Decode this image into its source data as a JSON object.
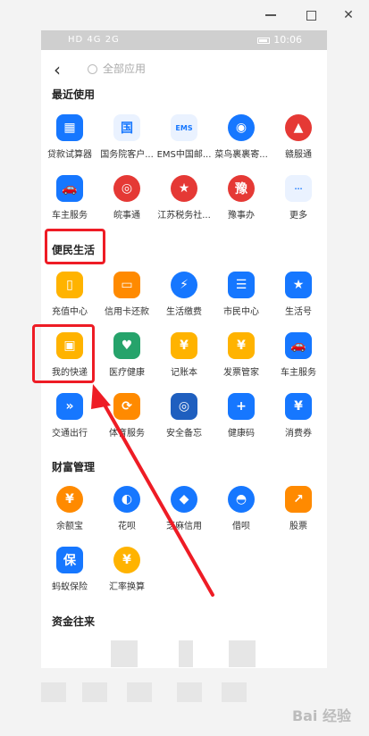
{
  "status": {
    "left": "HD 4G 2G",
    "time": "10:06"
  },
  "search": {
    "placeholder": "全部应用"
  },
  "sections": {
    "recent": "最近使用",
    "life": "便民生活",
    "wealth": "财富管理",
    "funds": "资金往来"
  },
  "recent": [
    {
      "label": "贷款试算器",
      "icon": "calc-icon",
      "sym": "▦"
    },
    {
      "label": "国务院客户...",
      "icon": "gov-icon",
      "sym": "国"
    },
    {
      "label": "EMS中国邮...",
      "icon": "ems-icon",
      "sym": "EMS"
    },
    {
      "label": "菜鸟裹裹寄...",
      "icon": "cainiao-icon",
      "sym": "◉"
    },
    {
      "label": "赣服通",
      "icon": "ganfu-icon",
      "sym": "▲"
    },
    {
      "label": "车主服务",
      "icon": "car-icon",
      "sym": "🚗"
    },
    {
      "label": "皖事通",
      "icon": "wanshi-icon",
      "sym": "◎"
    },
    {
      "label": "江苏税务社...",
      "icon": "tax-icon",
      "sym": "★"
    },
    {
      "label": "豫事办",
      "icon": "yushi-icon",
      "sym": "豫"
    },
    {
      "label": "更多",
      "icon": "more-icon",
      "sym": "···"
    }
  ],
  "life": [
    {
      "label": "充值中心",
      "icon": "phone-charge-icon",
      "sym": "▯"
    },
    {
      "label": "信用卡还款",
      "icon": "credit-card-icon",
      "sym": "▭"
    },
    {
      "label": "生活缴费",
      "icon": "utility-icon",
      "sym": "⚡"
    },
    {
      "label": "市民中心",
      "icon": "citizen-icon",
      "sym": "☰"
    },
    {
      "label": "生活号",
      "icon": "lifeaccount-icon",
      "sym": "★"
    },
    {
      "label": "我的快递",
      "icon": "delivery-icon",
      "sym": "▣"
    },
    {
      "label": "医疗健康",
      "icon": "health-icon",
      "sym": "♥"
    },
    {
      "label": "记账本",
      "icon": "ledger-icon",
      "sym": "¥"
    },
    {
      "label": "发票管家",
      "icon": "invoice-icon",
      "sym": "¥"
    },
    {
      "label": "车主服务",
      "icon": "car-icon",
      "sym": "🚗"
    },
    {
      "label": "交通出行",
      "icon": "transit-icon",
      "sym": "»"
    },
    {
      "label": "体育服务",
      "icon": "sports-icon",
      "sym": "⟳"
    },
    {
      "label": "安全备忘",
      "icon": "safe-icon",
      "sym": "◎"
    },
    {
      "label": "健康码",
      "icon": "healthcode-icon",
      "sym": "+"
    },
    {
      "label": "消费券",
      "icon": "coupon-icon",
      "sym": "¥"
    }
  ],
  "wealth": [
    {
      "label": "余额宝",
      "icon": "yuebao-icon",
      "sym": "¥"
    },
    {
      "label": "花呗",
      "icon": "huabei-icon",
      "sym": "◐"
    },
    {
      "label": "芝麻信用",
      "icon": "zhima-icon",
      "sym": "◆"
    },
    {
      "label": "借呗",
      "icon": "jiebei-icon",
      "sym": "◓"
    },
    {
      "label": "股票",
      "icon": "stock-icon",
      "sym": "↗"
    },
    {
      "label": "蚂蚁保险",
      "icon": "insurance-icon",
      "sym": "保"
    },
    {
      "label": "汇率换算",
      "icon": "exchange-icon",
      "sym": "¥"
    }
  ],
  "watermark": "Bai 经验"
}
